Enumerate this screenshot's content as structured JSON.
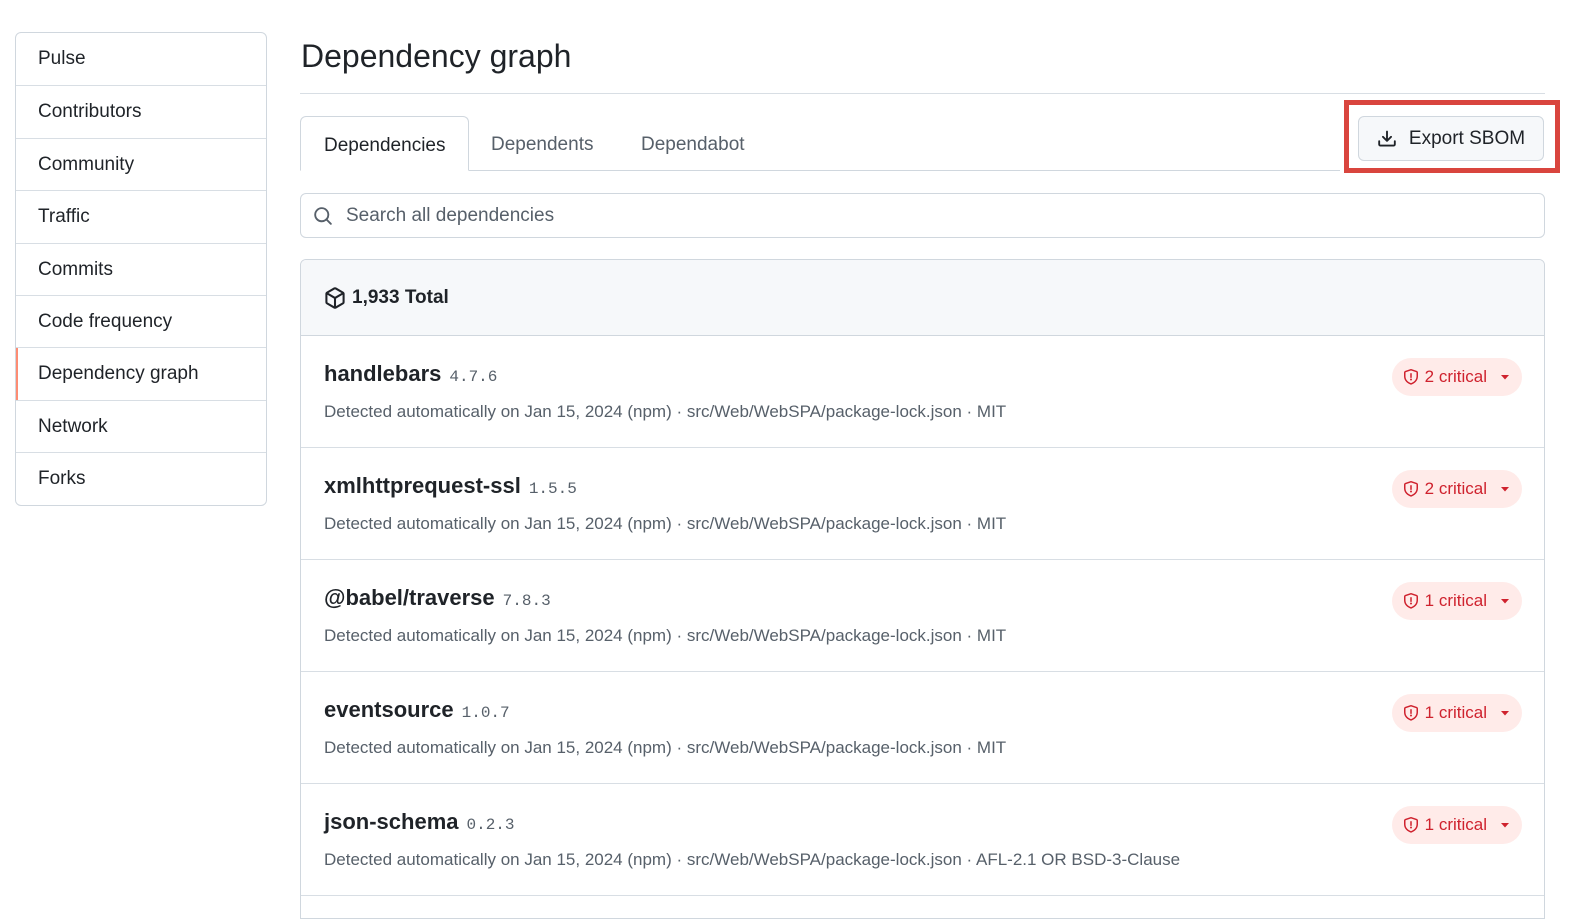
{
  "sidebar": {
    "items": [
      {
        "label": "Pulse"
      },
      {
        "label": "Contributors"
      },
      {
        "label": "Community"
      },
      {
        "label": "Traffic"
      },
      {
        "label": "Commits"
      },
      {
        "label": "Code frequency"
      },
      {
        "label": "Dependency graph",
        "active": true
      },
      {
        "label": "Network"
      },
      {
        "label": "Forks"
      }
    ]
  },
  "page": {
    "title": "Dependency graph"
  },
  "tabs": [
    {
      "label": "Dependencies",
      "selected": true
    },
    {
      "label": "Dependents"
    },
    {
      "label": "Dependabot"
    }
  ],
  "export": {
    "label": "Export SBOM",
    "icon": "download-icon"
  },
  "search": {
    "placeholder": "Search all dependencies",
    "value": ""
  },
  "summary": {
    "total": "1,933 Total",
    "icon": "package-icon"
  },
  "dependencies": [
    {
      "name": "handlebars",
      "version": "4.7.6",
      "detected": "Detected automatically on Jan 15, 2024 (npm) · src/Web/WebSPA/package-lock.json · MIT",
      "alert": "2 critical"
    },
    {
      "name": "xmlhttprequest-ssl",
      "version": "1.5.5",
      "detected": "Detected automatically on Jan 15, 2024 (npm) · src/Web/WebSPA/package-lock.json · MIT",
      "alert": "2 critical"
    },
    {
      "name": "@babel/traverse",
      "version": "7.8.3",
      "detected": "Detected automatically on Jan 15, 2024 (npm) · src/Web/WebSPA/package-lock.json · MIT",
      "alert": "1 critical"
    },
    {
      "name": "eventsource",
      "version": "1.0.7",
      "detected": "Detected automatically on Jan 15, 2024 (npm) · src/Web/WebSPA/package-lock.json · MIT",
      "alert": "1 critical"
    },
    {
      "name": "json-schema",
      "version": "0.2.3",
      "detected": "Detected automatically on Jan 15, 2024 (npm) · src/Web/WebSPA/package-lock.json · AFL-2.1 OR BSD-3-Clause",
      "alert": "1 critical"
    }
  ],
  "colors": {
    "accent_active": "#fd8c73",
    "critical": "#cf222e",
    "critical_bg": "#ffebe9",
    "highlight_box": "#d9453e"
  }
}
